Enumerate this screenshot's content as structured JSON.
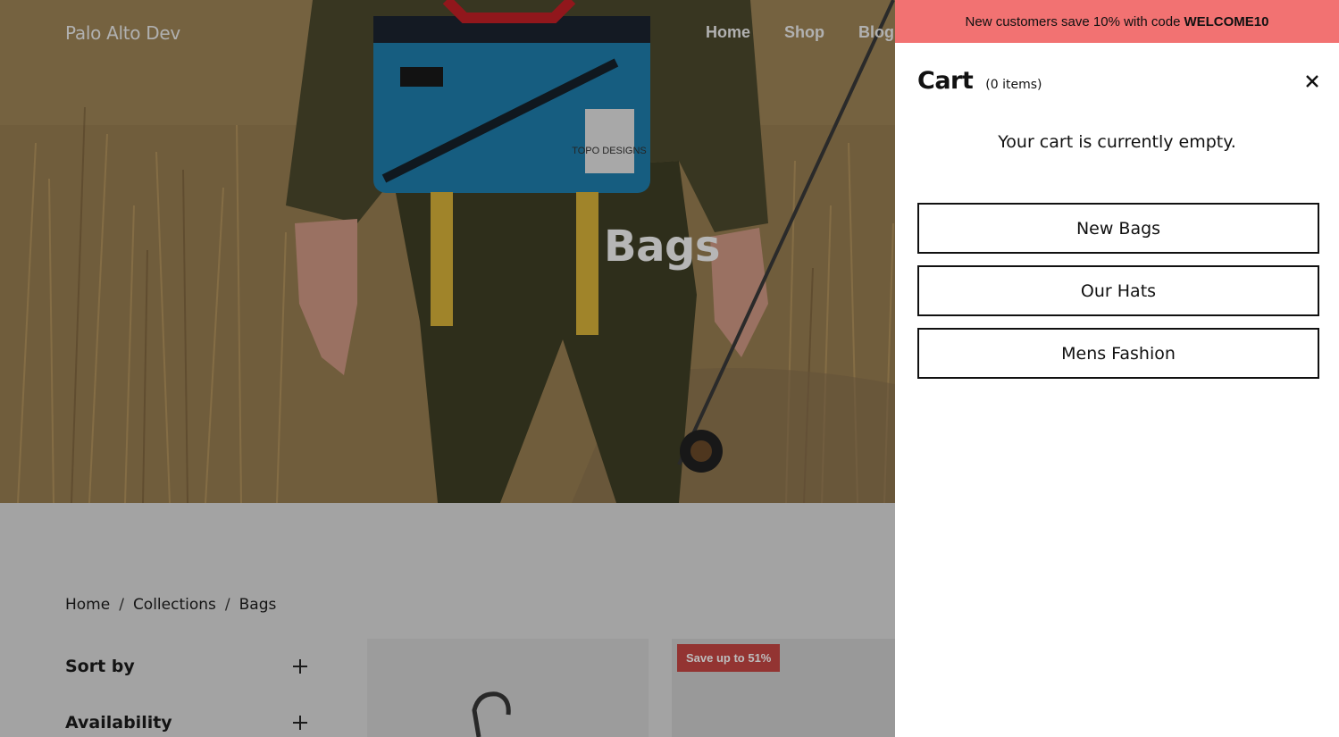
{
  "brand": {
    "name": "Palo Alto Dev"
  },
  "nav": {
    "links": [
      "Home",
      "Shop",
      "Blog"
    ]
  },
  "hero": {
    "title": "Bags",
    "tag_text": "TOPO DESIGNS"
  },
  "breadcrumb": {
    "items": [
      "Home",
      "Collections",
      "Bags"
    ],
    "separator": "/"
  },
  "filters": [
    {
      "label": "Sort by",
      "icon": "plus-icon"
    },
    {
      "label": "Availability",
      "icon": "plus-icon"
    }
  ],
  "products": {
    "badge": "Save up to 51%"
  },
  "promo": {
    "text": "New customers save 10% with code",
    "code": "WELCOME10"
  },
  "cart": {
    "title": "Cart",
    "count_label": "(0 items)",
    "empty_message": "Your cart is currently empty.",
    "close_icon": "close-icon",
    "links": [
      "New Bags",
      "Our Hats",
      "Mens Fashion"
    ]
  },
  "colors": {
    "promo_bg": "#f27272",
    "badge_bg": "#b8413f",
    "overlay": "rgba(0,0,0,0.2)"
  }
}
